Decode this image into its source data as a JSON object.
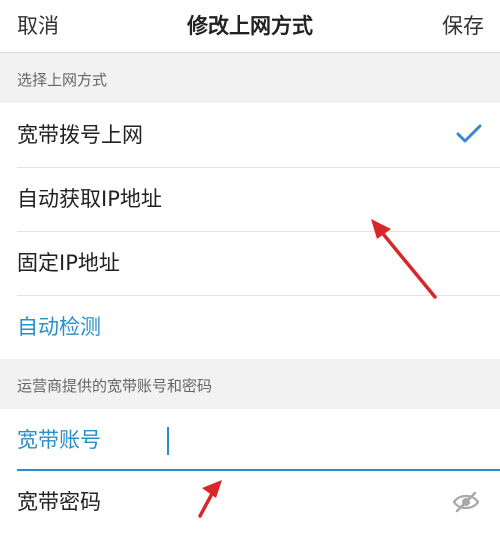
{
  "header": {
    "cancel_label": "取消",
    "title": "修改上网方式",
    "save_label": "保存"
  },
  "section1": {
    "title": "选择上网方式",
    "options": [
      {
        "label": "宽带拨号上网",
        "selected": true
      },
      {
        "label": "自动获取IP地址",
        "selected": false
      },
      {
        "label": "固定IP地址",
        "selected": false
      }
    ],
    "auto_detect_label": "自动检测"
  },
  "section2": {
    "title": "运营商提供的宽带账号和密码",
    "account_label": "宽带账号",
    "account_value": "",
    "password_label": "宽带密码"
  },
  "colors": {
    "accent": "#2a8fc9",
    "arrow": "#d9262b",
    "check": "#3a86d6"
  },
  "icons": {
    "selected": "checkmark-icon",
    "password_visibility": "eye-slash-icon",
    "annotation": "red-arrow-icon"
  }
}
